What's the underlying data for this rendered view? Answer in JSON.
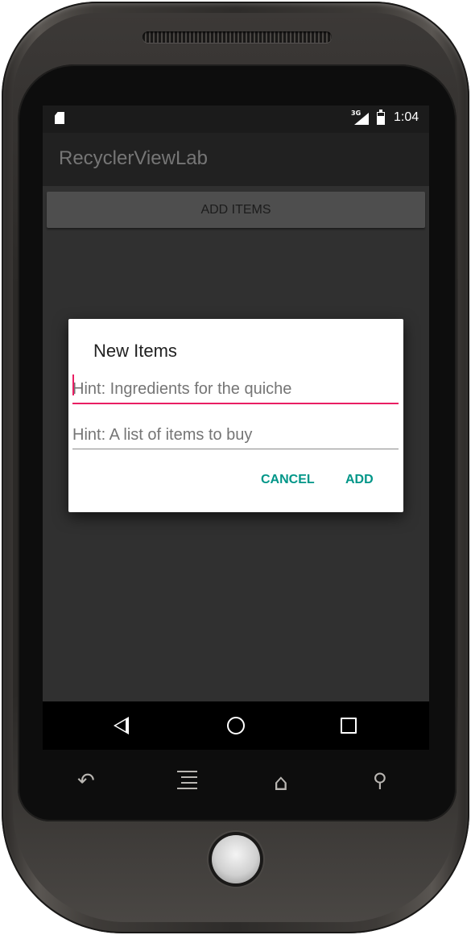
{
  "status_bar": {
    "network": "3G",
    "time": "1:04"
  },
  "app_bar": {
    "title": "RecyclerViewLab"
  },
  "main": {
    "add_items_label": "ADD ITEMS"
  },
  "dialog": {
    "title": "New Items",
    "field1": {
      "value": "",
      "placeholder": "Hint: Ingredients for the quiche"
    },
    "field2": {
      "value": "",
      "placeholder": "Hint: A list of items to buy"
    },
    "cancel_label": "CANCEL",
    "add_label": "ADD",
    "accent_color": "#009688",
    "focus_color": "#e91e63"
  },
  "nav_bar": {
    "icons": [
      "back-triangle-icon",
      "home-circle-icon",
      "recents-square-icon"
    ]
  },
  "hardware_keys": {
    "icons": [
      "hw-back-icon",
      "hw-menu-icon",
      "hw-home-icon",
      "hw-search-icon"
    ]
  }
}
